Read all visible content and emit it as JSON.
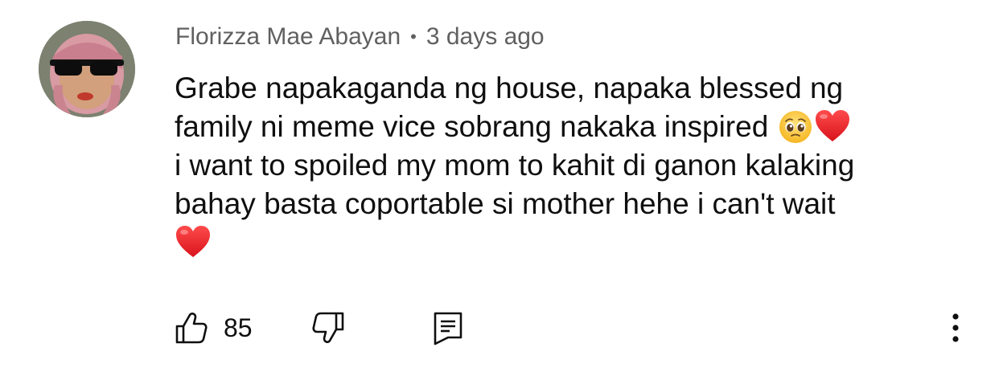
{
  "comment": {
    "author": "Florizza Mae Abayan",
    "separator": "•",
    "timestamp": "3 days ago",
    "text_lines": [
      "Grabe napakaganda ng house, napaka blessed ng",
      "family ni meme vice sobrang nakaka inspired ",
      "i want to spoiled my mom to kahit di ganon kalaking",
      "bahay basta coportable si mother hehe i can't wait",
      ""
    ],
    "emojis": [
      "pleading-face-emoji",
      "red-heart-emoji"
    ],
    "like_count": "85"
  },
  "icons": {
    "like": "thumbs-up-icon",
    "dislike": "thumbs-down-icon",
    "reply": "reply-comment-icon",
    "more": "more-vertical-icon"
  },
  "colors": {
    "text": "#0f0f0f",
    "meta": "#606060",
    "heart": "#e0202a",
    "background": "#ffffff"
  }
}
